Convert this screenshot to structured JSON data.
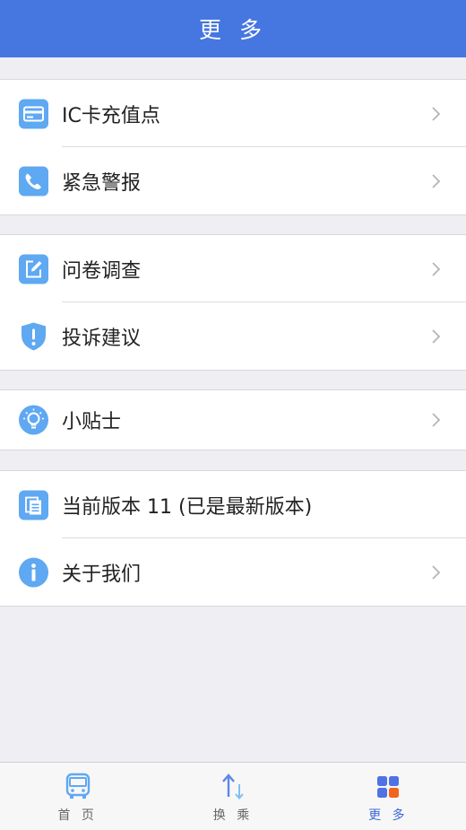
{
  "header": {
    "title": "更 多"
  },
  "groups": [
    {
      "items": [
        {
          "label": "IC卡充值点",
          "icon": "card-icon",
          "chevron": true
        },
        {
          "label": "紧急警报",
          "icon": "phone-icon",
          "chevron": true
        }
      ]
    },
    {
      "items": [
        {
          "label": "问卷调查",
          "icon": "edit-icon",
          "chevron": true
        },
        {
          "label": "投诉建议",
          "icon": "shield-alert-icon",
          "chevron": true
        }
      ]
    },
    {
      "items": [
        {
          "label": "小贴士",
          "icon": "lightbulb-icon",
          "chevron": true
        }
      ]
    },
    {
      "items": [
        {
          "label": "当前版本 11 (已是最新版本)",
          "icon": "document-icon",
          "chevron": false
        },
        {
          "label": "关于我们",
          "icon": "info-icon",
          "chevron": true
        }
      ]
    }
  ],
  "tabbar": {
    "tabs": [
      {
        "label": "首 页",
        "icon": "bus-icon",
        "active": false
      },
      {
        "label": "换 乘",
        "icon": "transfer-arrows-icon",
        "active": false
      },
      {
        "label": "更 多",
        "icon": "grid-icon",
        "active": true
      }
    ]
  },
  "colors": {
    "header": "#4677e0",
    "icon_blue": "#5fa8f2",
    "active_tab": "#3c67d6",
    "accent_orange": "#f2641e"
  }
}
